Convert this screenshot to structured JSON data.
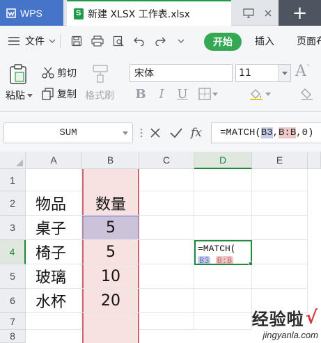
{
  "tabbar": {
    "app_tab_label": "WPS",
    "doc_tab_label": "新建 XLSX 工作表.xlsx",
    "new_tab_symbol": "+"
  },
  "menubar": {
    "file_label": "文件",
    "start_label": "开始",
    "insert_label": "插入",
    "page_label": "页面布"
  },
  "ribbon": {
    "paste_label": "粘贴",
    "cut_label": "剪切",
    "copy_label": "复制",
    "format_painter_label": "格式刷",
    "font_name": "宋体",
    "font_size": "11",
    "bold_label": "B",
    "italic_label": "I",
    "underline_label": "U",
    "grow_font_label": "A"
  },
  "formula_bar": {
    "name_box": "SUM",
    "fx_label": "fx",
    "formula_prefix": "=MATCH(",
    "ref1": "B3",
    "sep1": ",",
    "ref2": "B:B",
    "formula_suffix": ",0)"
  },
  "grid": {
    "columns": [
      "A",
      "B",
      "C",
      "D",
      "E"
    ],
    "active_column": "D",
    "rows": [
      "1",
      "2",
      "3",
      "4",
      "5",
      "6",
      "7",
      "8"
    ],
    "active_row": "4",
    "col_a": [
      "",
      "物品",
      "桌子",
      "椅子",
      "玻璃",
      "水杯",
      "",
      ""
    ],
    "col_b": [
      "",
      "数量",
      "5",
      "5",
      "10",
      "20",
      "",
      ""
    ],
    "edit_cell": {
      "line1": "=MATCH(",
      "hint_ref1": "B3",
      "hint_ref2": "B:B"
    }
  },
  "watermark": {
    "title": "经验啦",
    "check": "√",
    "url": "jingyanla.com"
  },
  "colors": {
    "accent_green": "#1e8a3c",
    "wps_blue": "#4574c9",
    "start_button": "#34a853",
    "range_red": "#c8686e",
    "range_blue": "#6b6fc0"
  }
}
